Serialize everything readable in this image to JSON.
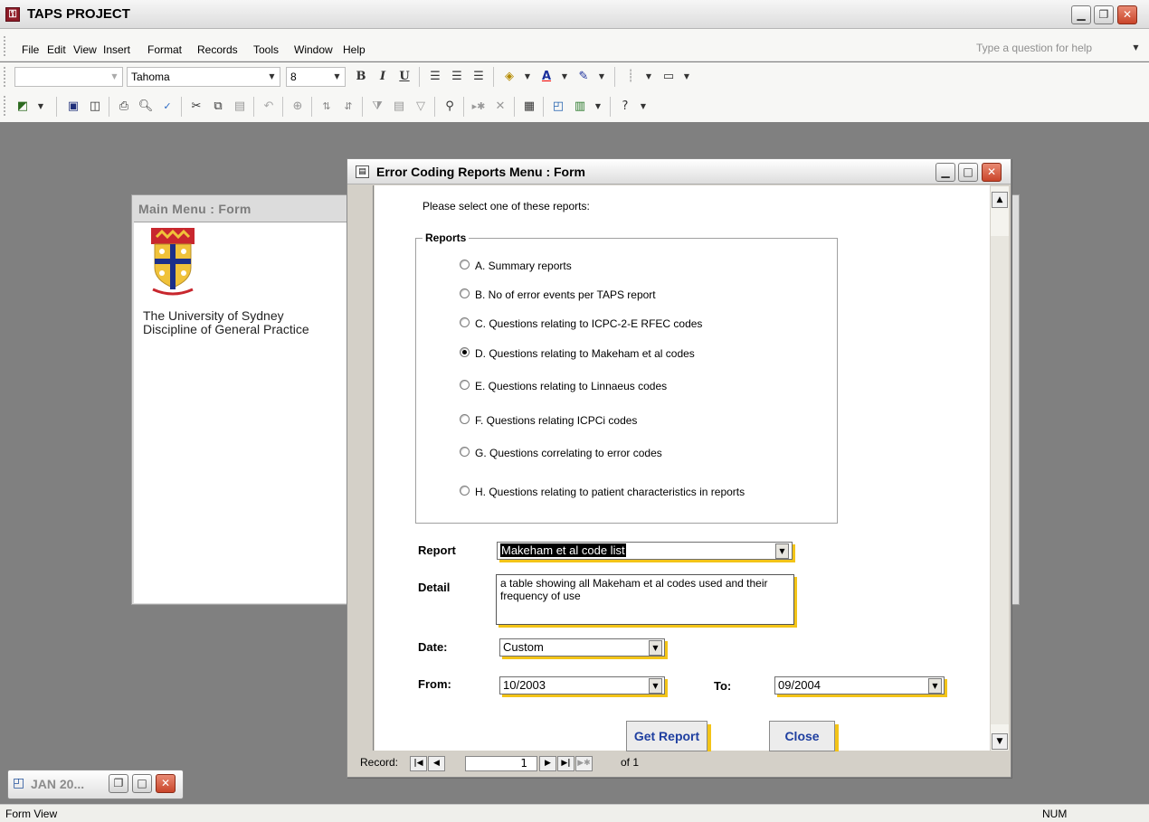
{
  "app": {
    "title": "TAPS PROJECT",
    "icon": "access-key-icon",
    "window_buttons": {
      "minimize": "‗",
      "restore": "❐",
      "close": "✕"
    }
  },
  "menubar": {
    "items": [
      "File",
      "Edit",
      "View",
      "Insert",
      "Format",
      "Records",
      "Tools",
      "Window",
      "Help"
    ],
    "help_placeholder": "Type a question for help"
  },
  "format_toolbar": {
    "object_combo": "",
    "font": "Tahoma",
    "size": "8",
    "bold": "B",
    "italic": "I",
    "underline": "U"
  },
  "main_menu": {
    "title": "Main Menu : Form",
    "crest": "university-crest-icon",
    "university": "The University of Sydney",
    "discipline": "Discipline of General Practice"
  },
  "form": {
    "title": "Error Coding Reports Menu : Form",
    "prompt": "Please select one of these reports:",
    "group_label": "Reports",
    "options": [
      {
        "label": "A. Summary reports",
        "selected": false
      },
      {
        "label": "B. No of error events per TAPS report",
        "selected": false
      },
      {
        "label": "C. Questions relating to ICPC-2-E RFEC codes",
        "selected": false
      },
      {
        "label": "D. Questions relating to Makeham et al codes",
        "selected": true
      },
      {
        "label": "E. Questions relating to Linnaeus codes",
        "selected": false
      },
      {
        "label": "F. Questions relating ICPCi  codes",
        "selected": false
      },
      {
        "label": "G. Questions correlating to error codes",
        "selected": false
      },
      {
        "label": "H. Questions relating to patient characteristics in reports",
        "selected": false
      }
    ],
    "report_label": "Report",
    "report_value": "Makeham et al code list",
    "detail_label": "Detail",
    "detail_text": "a table showing all Makeham et al codes used and their frequency of use",
    "date_label": "Date:",
    "date_value": "Custom",
    "from_label": "From:",
    "from_value": "10/2003",
    "to_label": "To:",
    "to_value": "09/2004",
    "get_report_label": "Get Report",
    "close_label": "Close"
  },
  "record_nav": {
    "label": "Record:",
    "current": "1",
    "total": "of  1"
  },
  "minimized_window": {
    "title": "JAN 20..."
  },
  "status": {
    "left": "Form View",
    "num": "NUM"
  },
  "colors": {
    "accent_shadow": "#f3c418",
    "button_text": "#1f3fa0",
    "close_red": "#c9452a"
  }
}
